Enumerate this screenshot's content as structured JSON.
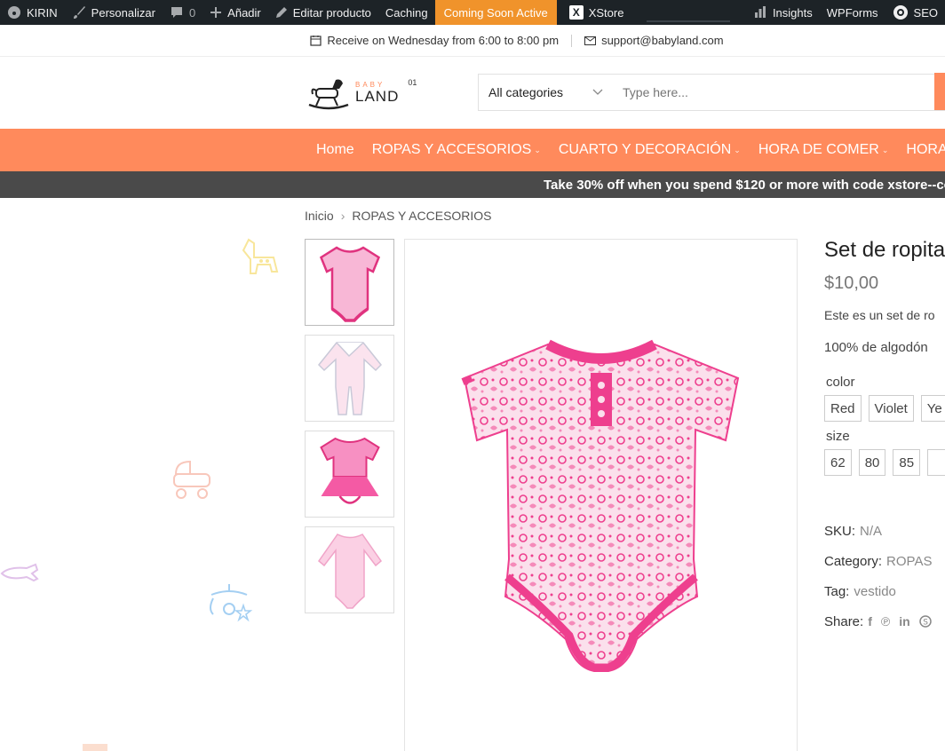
{
  "admin_bar": {
    "site_name": "KIRIN",
    "customize": "Personalizar",
    "comments": "0",
    "new": "Añadir",
    "edit_product": "Editar producto",
    "caching": "Caching",
    "coming_soon": "Coming Soon Active",
    "xstore": "XStore",
    "insights": "Insights",
    "wpforms": "WPForms",
    "seo": "SEO"
  },
  "top_info": {
    "delivery": "Receive on Wednesday from 6:00 to 8:00 pm",
    "email": "support@babyland.com"
  },
  "logo": {
    "baby": "BABY",
    "land": "LAND",
    "number": "01"
  },
  "search": {
    "category": "All categories",
    "placeholder": "Type here..."
  },
  "nav": {
    "items": [
      {
        "label": "Home"
      },
      {
        "label": "ROPAS Y ACCESORIOS"
      },
      {
        "label": "CUARTO Y DECORACIÓN"
      },
      {
        "label": "HORA DE COMER"
      },
      {
        "label": "HORA DE R"
      }
    ]
  },
  "promo": {
    "text": "Take 30% off when you spend $120 or more with code xstore--co"
  },
  "breadcrumb": {
    "home": "Inicio",
    "current": "ROPAS Y ACCESORIOS"
  },
  "product": {
    "title": "Set de ropita",
    "price": "$10,00",
    "description": "Este es un set de ro",
    "material": "100% de algodón",
    "color_label": "color",
    "colors": [
      "Red",
      "Violet",
      "Ye"
    ],
    "size_label": "size",
    "sizes": [
      "62",
      "80",
      "85",
      ""
    ],
    "sku_label": "SKU:",
    "sku": "N/A",
    "category_label": "Category:",
    "category": "ROPAS",
    "tag_label": "Tag:",
    "tag": "vestido",
    "share_label": "Share:"
  },
  "colors": {
    "accent": "#ff8a5c",
    "admin_bar": "#1d2327",
    "coming_soon": "#f0932b",
    "promo_bar": "#4a4a4a",
    "garment_pink": "#ee3f8e"
  }
}
